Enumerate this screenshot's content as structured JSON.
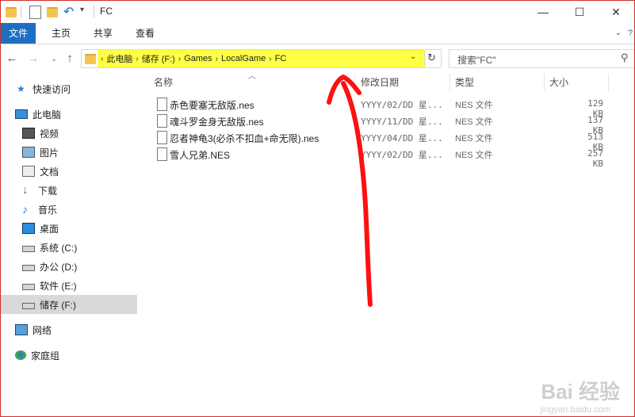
{
  "window": {
    "title": "FC",
    "controls": {
      "minimize": "—",
      "maximize": "☐",
      "close": "✕"
    }
  },
  "ribbon": {
    "tabs": [
      "文件",
      "主页",
      "共享",
      "查看"
    ]
  },
  "address": {
    "segments": [
      "此电脑",
      "储存 (F:)",
      "Games",
      "LocalGame",
      "FC"
    ]
  },
  "search": {
    "placeholder": "搜索\"FC\""
  },
  "nav": {
    "items": [
      {
        "label": "快速访问",
        "icon": "star-icon"
      },
      {
        "label": "此电脑",
        "icon": "computer-icon"
      },
      {
        "label": "视频",
        "icon": "video-icon"
      },
      {
        "label": "图片",
        "icon": "pictures-icon"
      },
      {
        "label": "文档",
        "icon": "documents-icon"
      },
      {
        "label": "下载",
        "icon": "download-icon"
      },
      {
        "label": "音乐",
        "icon": "music-icon"
      },
      {
        "label": "桌面",
        "icon": "desktop-icon"
      },
      {
        "label": "系统 (C:)",
        "icon": "drive-icon"
      },
      {
        "label": "办公 (D:)",
        "icon": "drive-icon"
      },
      {
        "label": "软件 (E:)",
        "icon": "drive-icon"
      },
      {
        "label": "储存 (F:)",
        "icon": "drive-icon",
        "selected": true
      },
      {
        "label": "网络",
        "icon": "network-icon"
      },
      {
        "label": "家庭组",
        "icon": "homegroup-icon"
      }
    ]
  },
  "files": {
    "columns": {
      "name": "名称",
      "date": "修改日期",
      "type": "类型",
      "size": "大小"
    },
    "rows": [
      {
        "name": "赤色要塞无敌版.nes",
        "date": "YYYY/02/DD 星...",
        "type": "NES 文件",
        "size": "129 KB"
      },
      {
        "name": "魂斗罗金身无敌版.nes",
        "date": "YYYY/11/DD 星...",
        "type": "NES 文件",
        "size": "137 KB"
      },
      {
        "name": "忍者神龟3(必杀不扣血+命无限).nes",
        "date": "YYYY/04/DD 星...",
        "type": "NES 文件",
        "size": "513 KB"
      },
      {
        "name": "雪人兄弟.NES",
        "date": "YYYY/02/DD 星...",
        "type": "NES 文件",
        "size": "257 KB"
      }
    ]
  },
  "watermark": {
    "brand": "Bai 经验",
    "url": "jingyan.baidu.com"
  },
  "colors": {
    "accent": "#1e6fc2",
    "highlight": "#ffff45",
    "annotation": "#ff1010",
    "border": "#d02f2f"
  }
}
